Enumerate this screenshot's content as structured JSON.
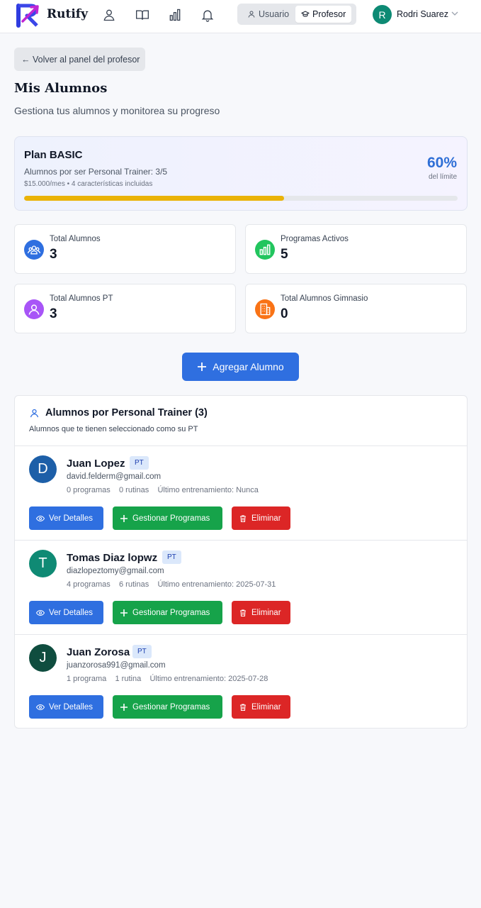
{
  "header": {
    "brand": "Rutify",
    "mode_user": "Usuario",
    "mode_teacher": "Profesor",
    "user_initial": "R",
    "user_name": "Rodri Suarez"
  },
  "back_button": "← Volver al panel del profesor",
  "page": {
    "title": "Mis Alumnos",
    "subtitle": "Gestiona tus alumnos y monitorea su progreso"
  },
  "plan": {
    "name": "Plan BASIC",
    "limit_text": "Alumnos por ser Personal Trainer: 3/5",
    "price_text": "$15.000/mes • 4 características incluidas",
    "percent_text": "60%",
    "percent_label": "del límite",
    "usage_fraction": 0.6,
    "bar_color": "#eab308"
  },
  "stats": [
    {
      "label": "Total Alumnos",
      "value": "3",
      "icon": "users-group-icon",
      "color": "#2f6fe0"
    },
    {
      "label": "Programas Activos",
      "value": "5",
      "icon": "bar-chart-icon",
      "color": "#22c55e"
    },
    {
      "label": "Total Alumnos PT",
      "value": "3",
      "icon": "user-circle-icon",
      "color": "#a855f7"
    },
    {
      "label": "Total Alumnos Gimnasio",
      "value": "0",
      "icon": "building-icon",
      "color": "#f97316"
    }
  ],
  "add_button": "Agregar Alumno",
  "section": {
    "title": "Alumnos por Personal Trainer (3)",
    "subtitle": "Alumnos que te tienen seleccionado como su PT"
  },
  "actions": {
    "view": "Ver Detalles",
    "manage": "Gestionar Programas",
    "delete": "Eliminar"
  },
  "students": [
    {
      "initial": "D",
      "name": "Juan Lopez",
      "badge": "PT",
      "email": "david.felderm@gmail.com",
      "programs": "0 programas",
      "routines": "0 rutinas",
      "last": "Último entrenamiento: Nunca",
      "avatar_color": "#1d5fa8"
    },
    {
      "initial": "T",
      "name": "Tomas Diaz lopwz",
      "badge": "PT",
      "email": "diazlopeztomy@gmail.com",
      "programs": "4 programas",
      "routines": "6 rutinas",
      "last": "Último entrenamiento: 2025-07-31",
      "avatar_color": "#0f8a74"
    },
    {
      "initial": "J",
      "name": "Juan Zorosa",
      "badge": "PT",
      "email": "juanzorosa991@gmail.com",
      "programs": "1 programa",
      "routines": "1 rutina",
      "last": "Último entrenamiento: 2025-07-28",
      "avatar_color": "#0f4d3f"
    }
  ]
}
